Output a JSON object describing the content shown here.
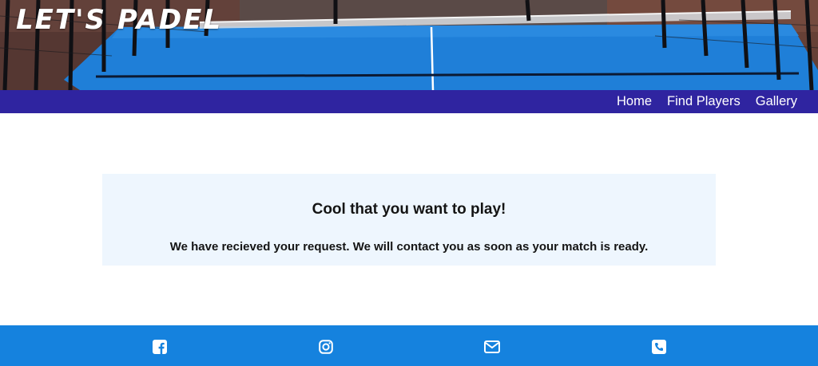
{
  "header": {
    "brand": "LET'S PADEL"
  },
  "nav": {
    "items": [
      {
        "label": "Home"
      },
      {
        "label": "Find Players"
      },
      {
        "label": "Gallery"
      }
    ]
  },
  "confirmation": {
    "title": "Cool that you want to play!",
    "message": "We have recieved your request. We will contact you as soon as your match is ready."
  },
  "footer": {
    "icons": [
      "facebook-icon",
      "instagram-icon",
      "envelope-icon",
      "phone-icon"
    ]
  },
  "colors": {
    "nav_bg": "#2f24a0",
    "footer_bg": "#1582de",
    "card_bg": "#eef6fe",
    "court_blue": "#1f7fd8"
  }
}
